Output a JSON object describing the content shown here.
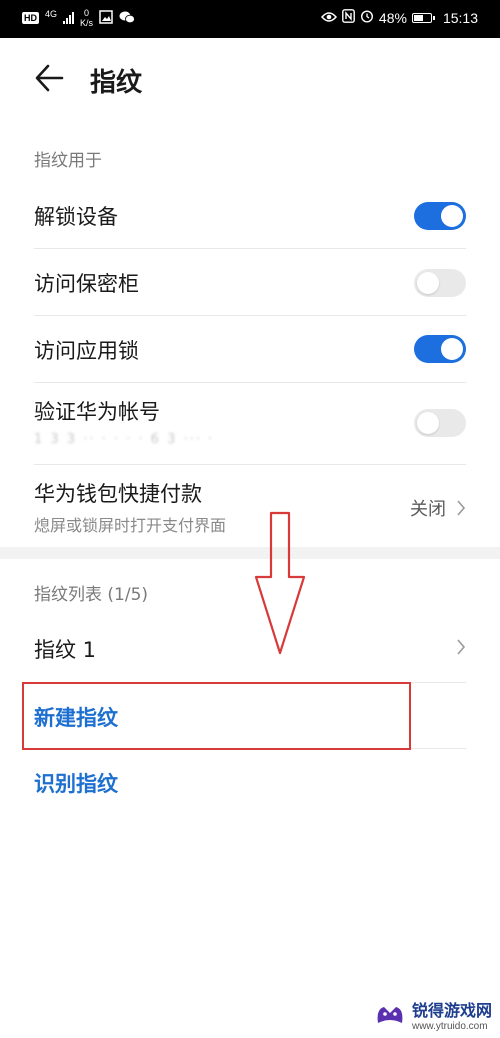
{
  "status_bar": {
    "hd": "HD",
    "network": "4G",
    "speed_value": "0",
    "speed_unit": "K/s",
    "battery": "48%",
    "time": "15:13",
    "icons": [
      "image-icon",
      "wechat-icon",
      "eye-icon",
      "nfc-icon",
      "alarm-icon",
      "battery-icon"
    ]
  },
  "header": {
    "back_icon": "arrow-left-icon",
    "title": "指纹"
  },
  "usage_section": {
    "label": "指纹用于",
    "items": [
      {
        "title": "解锁设备",
        "toggle": "on"
      },
      {
        "title": "访问保密柜",
        "toggle": "off"
      },
      {
        "title": "访问应用锁",
        "toggle": "on"
      },
      {
        "title": "验证华为帐号",
        "masked_subtitle": "1 3 3 ·· · · · · 6 3 ··· ·",
        "toggle": "off"
      },
      {
        "title": "华为钱包快捷付款",
        "subtitle": "熄屏或锁屏时打开支付界面",
        "value": "关闭"
      }
    ]
  },
  "list_section": {
    "label": "指纹列表 (1/5)",
    "items": [
      {
        "title": "指纹 1"
      }
    ],
    "new_fingerprint": "新建指纹",
    "identify_fingerprint": "识别指纹"
  },
  "annotation": {
    "color": "#d83a3a"
  },
  "watermark": {
    "name": "锐得游戏网",
    "url": "www.ytruido.com"
  },
  "colors": {
    "accent": "#1d6fe0",
    "link": "#1d6fd0",
    "toggle_off": "#e9e9e9"
  }
}
